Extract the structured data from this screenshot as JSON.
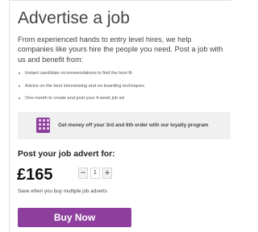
{
  "page": {
    "title": "Advertise a job",
    "intro": "From experienced hands to entry level hires, we help companies like yours hire the people you need. Post a job with us and benefit from:"
  },
  "benefits": [
    {
      "label": "Instant candidate recommendations to find the best fit"
    },
    {
      "label": "Advice on the best interviewing and on-boarding techniques"
    },
    {
      "label": "One month to create and post your 4-week job ad"
    }
  ],
  "loyalty": {
    "icon": "loyalty-card-icon",
    "text": "Get money off your 3rd and 6th order with our loyalty program",
    "icon_color": "#8b3f98",
    "background": "#f0f0f0"
  },
  "pricing": {
    "heading": "Post your job advert for:",
    "price": "£165",
    "quantity": "1",
    "decrement_label": "−",
    "increment_label": "+",
    "note": "Save when you buy multiple job adverts"
  },
  "buy_button": {
    "label": "Buy Now",
    "color": "#8e3f9d"
  }
}
